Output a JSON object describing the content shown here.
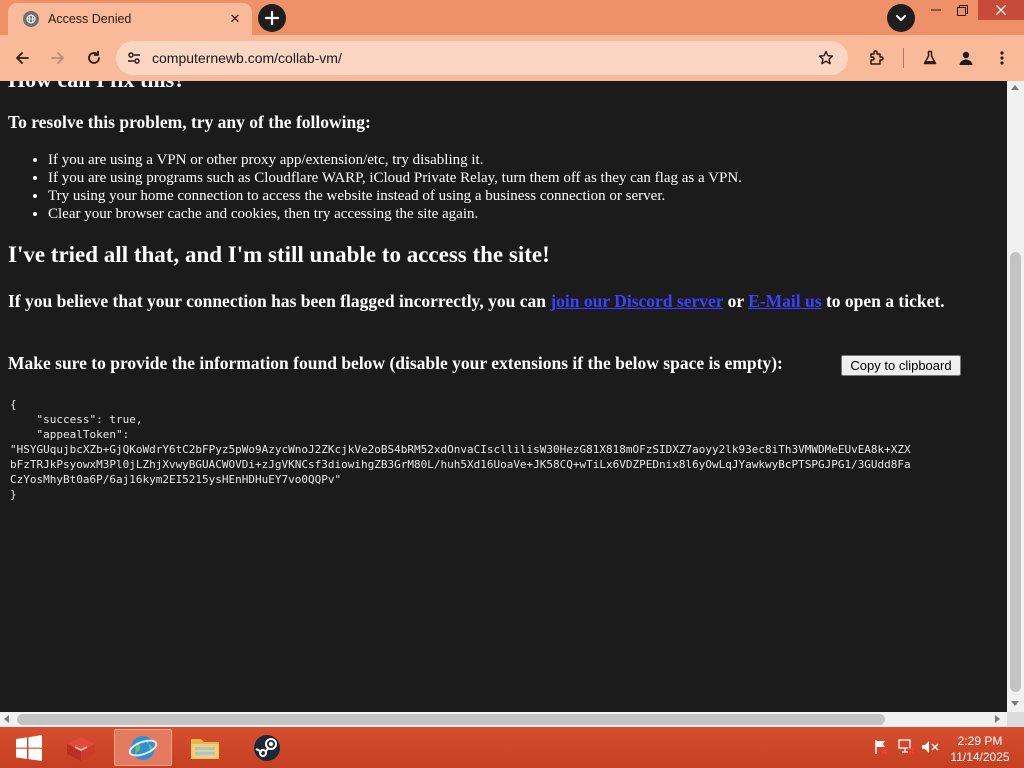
{
  "browser": {
    "tab": {
      "title": "Access Denied",
      "favicon": "globe-icon"
    },
    "url": "computernewb.com/collab-vm/"
  },
  "content": {
    "partial_heading": "How can I fix this?",
    "resolve_heading": "To resolve this problem, try any of the following:",
    "tips": [
      "If you are using a VPN or other proxy app/extension/etc, try disabling it.",
      "If you are using programs such as Cloudflare WARP, iCloud Private Relay, turn them off as they can flag as a VPN.",
      "Try using your home connection to access the website instead of using a business connection or server.",
      "Clear your browser cache and cookies, then try accessing the site again."
    ],
    "tried_heading": "I've tried all that, and I'm still unable to access the site!",
    "flag": {
      "before": "If you believe that your connection has been flagged incorrectly, you can ",
      "link1": "join our Discord server",
      "middle": " or ",
      "link2": "E-Mail us",
      "after": " to open a ticket."
    },
    "info_text": "Make sure to provide the information found below (disable your extensions if the below space is empty):",
    "copy_button": "Copy to clipboard",
    "json_block": "{\n    \"success\": true,\n    \"appealToken\":\n\"HSYGUqujbcXZb+GjQKoWdrY6tC2bFPyz5pWo9AzycWnoJ2ZKcjkVe2oBS4bRM52xdOnvaCIscllilisW30HezG81X818mOFzSIDXZ7aoyy2lk93ec8iTh3VMWDMeEUvEA8k+XZX\nbFzTRJkPsyowxM3Pl0jLZhjXvwyBGUACWOVDi+zJgVKNCsf3diowihgZB3GrM80L/huh5Xd16UoaVe+JK58CQ+wTiLx6VDZPEDnix8l6yOwLqJYawkwyBcPTSPGJPG1/3GUdd8Fa\nCzYosMhyBt0a6P/6aj16kym2EI5215ysHEnHDHuEY7vo0QQPv\"\n}"
  },
  "taskbar": {
    "time": "2:29 PM",
    "date": "11/14/2025"
  },
  "colors": {
    "titlebar": "#ee9168",
    "toolbar": "#f8ba99",
    "page_bg": "#1b1b1b",
    "link": "#3b41ff",
    "taskbar": "#cc4527"
  }
}
